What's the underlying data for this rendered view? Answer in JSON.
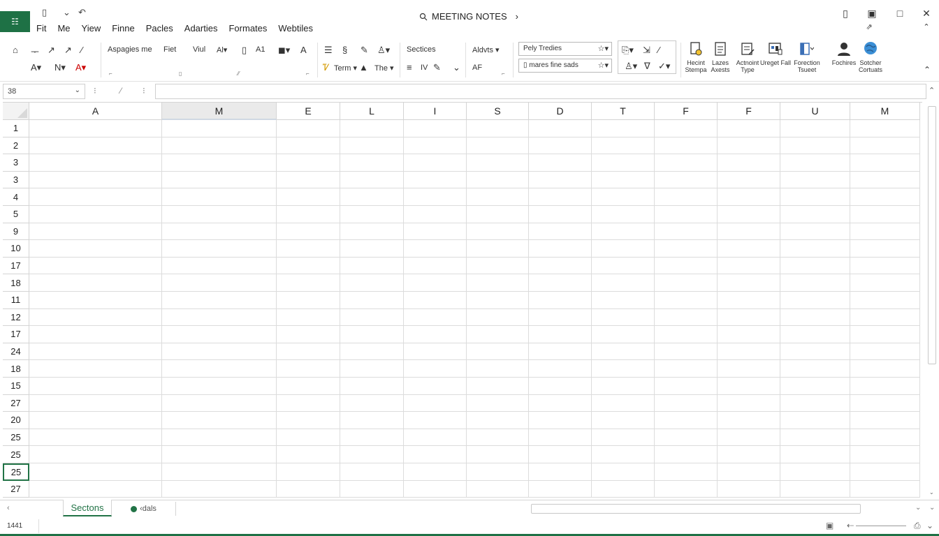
{
  "app": {
    "icon_glyph": "☷",
    "accent": "#217346",
    "brand": "#1e7145"
  },
  "title": {
    "doc_name": "MEETING NOTES",
    "doc_icon": "search-document-icon",
    "chevron": "›"
  },
  "quick_access": {
    "new_glyph": "▯",
    "dropdown_glyph": "⌄",
    "undo_glyph": "↶"
  },
  "window": {
    "restore_glyph": "▯",
    "tile_glyph": "▣",
    "max_glyph": "□",
    "close_glyph": "✕",
    "extra1_glyph": "⇗",
    "extra2_glyph": "⌃"
  },
  "menu": [
    "Fit",
    "Me",
    "Yiew",
    "Finne",
    "Pacles",
    "Adarties",
    "Formates",
    "Webtiles"
  ],
  "ribbon": {
    "row1": {
      "font_name": "Aspagies me",
      "font_style": "Fiet",
      "font_size": "Viul",
      "grow": "Al▾",
      "cell_style_a": "A1",
      "sections": "Sectices",
      "adds": "Aldvts ▾",
      "style_box": "Pely Tredies"
    },
    "row2": {
      "term": "Term ▾",
      "the": "The ▾",
      "wrap": "IV",
      "af": "AF",
      "find_box": "mares fine sads"
    },
    "big_buttons": [
      {
        "label": "Hecint Stempa"
      },
      {
        "label": "Lazes Axests"
      },
      {
        "label": "Actnoint Type"
      },
      {
        "label": "Ureget Fall"
      },
      {
        "label": "Forection Tsueet"
      },
      {
        "label": "Fochires"
      },
      {
        "label": "Sotcher Cortuats"
      }
    ],
    "collapse_glyph": "⌃"
  },
  "formula_bar": {
    "name_box": "38",
    "name_dropdown": "⌄",
    "cancel": "⁝",
    "confirm": "⁄",
    "fx": "⁝",
    "collapse": "⌃"
  },
  "grid": {
    "columns": [
      "A",
      "M",
      "E",
      "L",
      "I",
      "S",
      "D",
      "T",
      "F",
      "F",
      "U",
      "M"
    ],
    "selected_column": 1,
    "rows": [
      "1",
      "2",
      "3",
      "3",
      "4",
      "5",
      "9",
      "10",
      "17",
      "18",
      "11",
      "12",
      "17",
      "24",
      "18",
      "15",
      "27",
      "20",
      "25",
      "25",
      "25",
      "27"
    ],
    "selected_row": 20
  },
  "sheets": {
    "nav_left": "‹",
    "active": "Sectons",
    "add_label": "‹dals",
    "scroll_end": "⌄"
  },
  "status": {
    "text": "1441",
    "page_icon": "▣",
    "zoom_left": "⇠",
    "zoom_icon": "⎙",
    "zoom_dd": "⌄"
  }
}
